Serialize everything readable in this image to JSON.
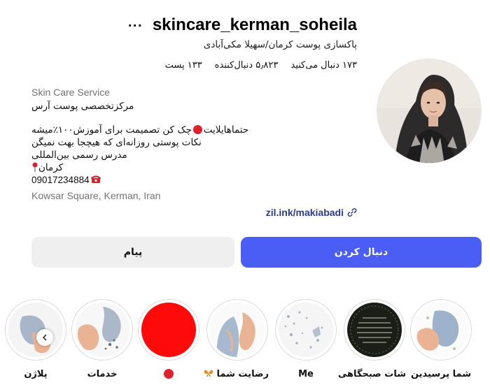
{
  "profile": {
    "username": "skincare_kerman_soheila",
    "more_icon": "more-options-icon",
    "fullname": "پاکسازی پوست کرمان/سهیلا مکی‌آبادی",
    "stats": {
      "posts": "۱۳۳ پست",
      "followers": "۵٫۸۲۳ دنبال‌کننده",
      "following": "۱۷۳ دنبال می‌کنید"
    },
    "category": "Skin Care Service",
    "bio": {
      "line1": "مرکزتخصصی پوست آرس",
      "line2_part1": "حتماهایلایت",
      "line2_part2": "چک کن تصمیمت برای آموزش۱۰۰٪میشه",
      "line3": "نکات پوستی روزانه‌ای که هیچجا بهت نمیگن",
      "line4": "مدرس رسمی بین‌المللی",
      "line5": "کرمان",
      "phone": "09017234884"
    },
    "address": "Kowsar Square, Kerman, Iran",
    "link": "zil.ink/makiabadi"
  },
  "actions": {
    "follow": "دنبال کردن",
    "message": "پیام"
  },
  "highlights": [
    {
      "label": "شما پرسیدین"
    },
    {
      "label": "شات صبحگاهی"
    },
    {
      "label": "Me"
    },
    {
      "label": "رضایت شما"
    },
    {
      "label": ""
    },
    {
      "label": "خدمات"
    },
    {
      "label": "پلاژن"
    }
  ],
  "colors": {
    "follow_button": "#4a5df5",
    "message_button": "#efefef",
    "link": "#2a3a8f",
    "red_dot": "#e0202a"
  }
}
